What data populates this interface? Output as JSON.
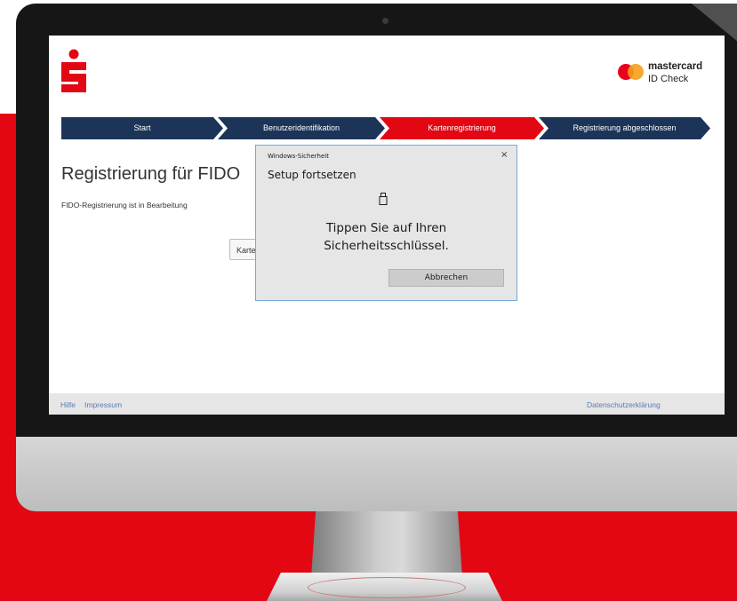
{
  "header": {
    "logo_left": "sparkasse-logo",
    "mastercard_word": "mastercard",
    "mastercard_sub": "ID Check"
  },
  "steps": [
    {
      "label": "Start",
      "state": "done",
      "color": "#1c3458"
    },
    {
      "label": "Benutzeridentifikation",
      "state": "done",
      "color": "#1c3458"
    },
    {
      "label": "Kartenregistrierung",
      "state": "active",
      "color": "#e30613"
    },
    {
      "label": "Registrierung abgeschlossen",
      "state": "pending",
      "color": "#1c3458"
    }
  ],
  "main": {
    "title": "Registrierung für FIDO",
    "status": "FIDO-Registrierung ist in Bearbeitung",
    "button_label": "Karte"
  },
  "footer": {
    "help": "Hilfe",
    "imprint": "Impressum",
    "privacy": "Datenschutzerklärung"
  },
  "dialog": {
    "caption": "Windows-Sicherheit",
    "close": "×",
    "title": "Setup fortsetzen",
    "icon": "usb-key-icon",
    "message_line1": "Tippen Sie auf Ihren",
    "message_line2": "Sicherheitsschlüssel.",
    "cancel": "Abbrechen"
  },
  "colors": {
    "brand_red": "#e30613",
    "navy": "#1c3458",
    "footer_link": "#5a7bb5"
  }
}
